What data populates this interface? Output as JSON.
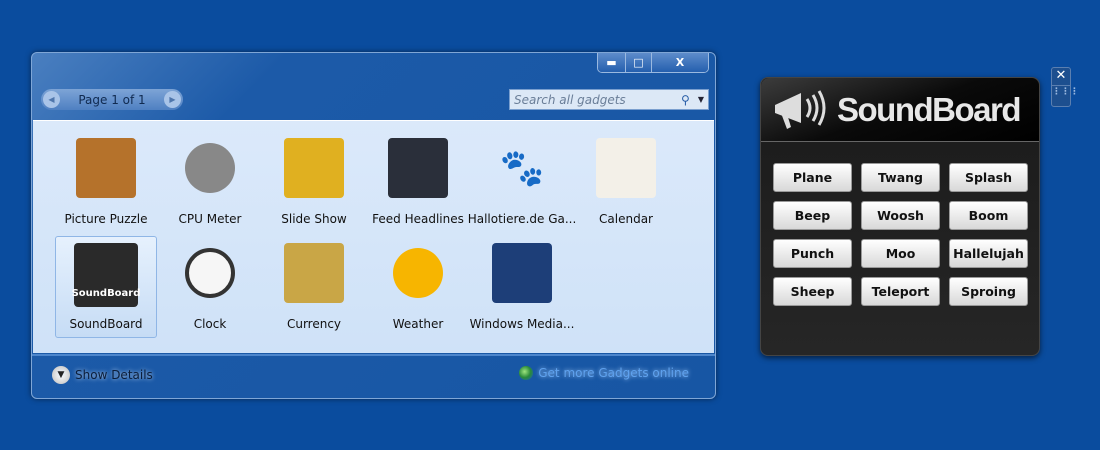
{
  "window": {
    "caption_buttons": {
      "minimize": "▬",
      "maximize": "□",
      "close": "X"
    },
    "pager": {
      "label": "Page 1 of 1",
      "prev": "◀",
      "next": "▶"
    },
    "search": {
      "placeholder": "Search all gadgets",
      "icon": "search-icon",
      "dropdown": "▼"
    },
    "gadgets": [
      {
        "label": "Picture Puzzle",
        "icon": "puzzle-icon",
        "color": "#b5722b"
      },
      {
        "label": "CPU Meter",
        "icon": "cpu-meter-icon",
        "color": "#888888"
      },
      {
        "label": "Slide Show",
        "icon": "slideshow-icon",
        "color": "#e0b020"
      },
      {
        "label": "Feed Headlines",
        "icon": "feed-icon",
        "color": "#2a2f3a"
      },
      {
        "label": "Hallotiere.de Ga...",
        "icon": "paw-icon",
        "color": "#1f5d9e"
      },
      {
        "label": "Calendar",
        "icon": "calendar-icon",
        "color": "#f3f0e8"
      },
      {
        "label": "SoundBoard",
        "icon": "megaphone-icon",
        "color": "#2a2a2a",
        "selected": true
      },
      {
        "label": "Clock",
        "icon": "clock-icon",
        "color": "#f6f6f6"
      },
      {
        "label": "Currency",
        "icon": "currency-icon",
        "color": "#c9a646"
      },
      {
        "label": "Weather",
        "icon": "sun-icon",
        "color": "#f7b500"
      },
      {
        "label": "Windows Media...",
        "icon": "media-center-icon",
        "color": "#1d3e78"
      }
    ],
    "footer": {
      "show_details": "Show Details",
      "get_more": "Get more Gadgets online"
    }
  },
  "soundboard": {
    "title": "SoundBoard",
    "close": "✕",
    "buttons": [
      "Plane",
      "Twang",
      "Splash",
      "Beep",
      "Woosh",
      "Boom",
      "Punch",
      "Moo",
      "Hallelujah",
      "Sheep",
      "Teleport",
      "Sproing"
    ]
  }
}
